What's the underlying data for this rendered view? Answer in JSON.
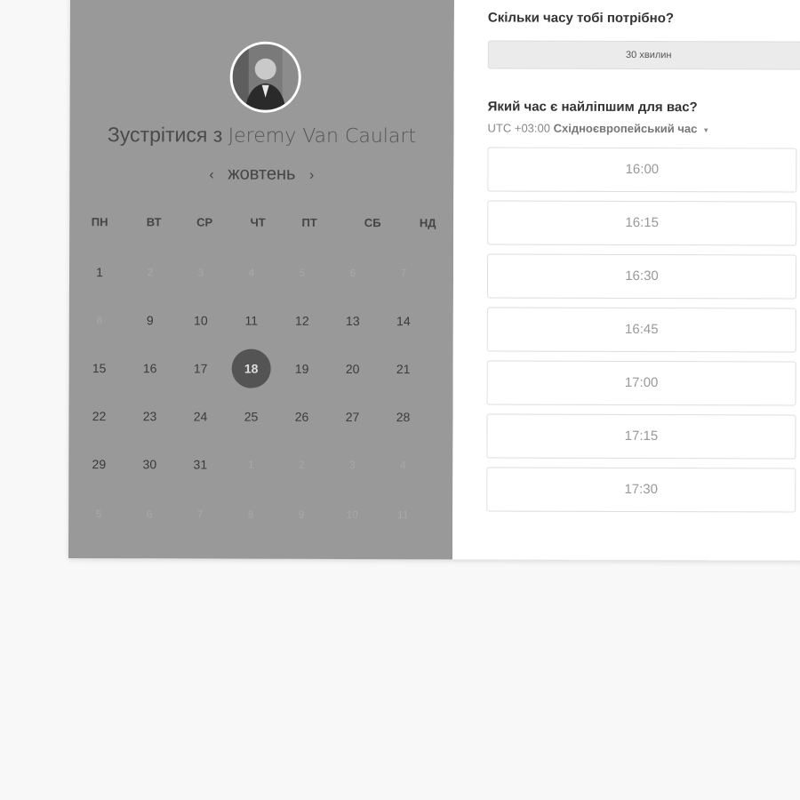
{
  "host": {
    "meet_prefix": "Зустрітися з",
    "name": "Jeremy Van Caulart"
  },
  "calendar": {
    "month": "жовтень",
    "prev_icon": "‹",
    "next_icon": "›",
    "weekdays": [
      "ПН",
      "ВТ",
      "СР",
      "ЧТ",
      "ПТ",
      "СБ",
      "НД"
    ],
    "weeks": [
      [
        {
          "d": "1",
          "m": false
        },
        {
          "d": "2",
          "m": true
        },
        {
          "d": "3",
          "m": true
        },
        {
          "d": "4",
          "m": true
        },
        {
          "d": "5",
          "m": true
        },
        {
          "d": "6",
          "m": true
        },
        {
          "d": "7",
          "m": true
        }
      ],
      [
        {
          "d": "8",
          "m": true
        },
        {
          "d": "9",
          "m": false
        },
        {
          "d": "10",
          "m": false
        },
        {
          "d": "11",
          "m": false
        },
        {
          "d": "12",
          "m": false
        },
        {
          "d": "13",
          "m": false
        },
        {
          "d": "14",
          "m": false
        }
      ],
      [
        {
          "d": "15",
          "m": false
        },
        {
          "d": "16",
          "m": false
        },
        {
          "d": "17",
          "m": false
        },
        {
          "d": "18",
          "m": false,
          "s": true
        },
        {
          "d": "19",
          "m": false
        },
        {
          "d": "20",
          "m": false
        },
        {
          "d": "21",
          "m": false
        }
      ],
      [
        {
          "d": "22",
          "m": false
        },
        {
          "d": "23",
          "m": false
        },
        {
          "d": "24",
          "m": false
        },
        {
          "d": "25",
          "m": false
        },
        {
          "d": "26",
          "m": false
        },
        {
          "d": "27",
          "m": false
        },
        {
          "d": "28",
          "m": false
        }
      ],
      [
        {
          "d": "29",
          "m": false
        },
        {
          "d": "30",
          "m": false
        },
        {
          "d": "31",
          "m": false
        },
        {
          "d": "1",
          "m": true
        },
        {
          "d": "2",
          "m": true
        },
        {
          "d": "3",
          "m": true
        },
        {
          "d": "4",
          "m": true
        }
      ],
      [
        {
          "d": "5",
          "m": true
        },
        {
          "d": "6",
          "m": true
        },
        {
          "d": "7",
          "m": true
        },
        {
          "d": "8",
          "m": true
        },
        {
          "d": "9",
          "m": true
        },
        {
          "d": "10",
          "m": true
        },
        {
          "d": "11",
          "m": true
        }
      ]
    ],
    "selected_day": "18"
  },
  "duration": {
    "question": "Скільки часу тобі потрібно?",
    "value": "30 хвилин"
  },
  "time": {
    "question": "Який час є найліпшим для вас?",
    "tz_offset": "UTC +03:00",
    "tz_name": "Східноєвропейський час",
    "tz_caret": "▾",
    "slots": [
      "16:00",
      "16:15",
      "16:30",
      "16:45",
      "17:00",
      "17:15",
      "17:30",
      ""
    ]
  },
  "colors": {
    "left_panel": "#999999",
    "selected_day_bg": "#545454"
  }
}
